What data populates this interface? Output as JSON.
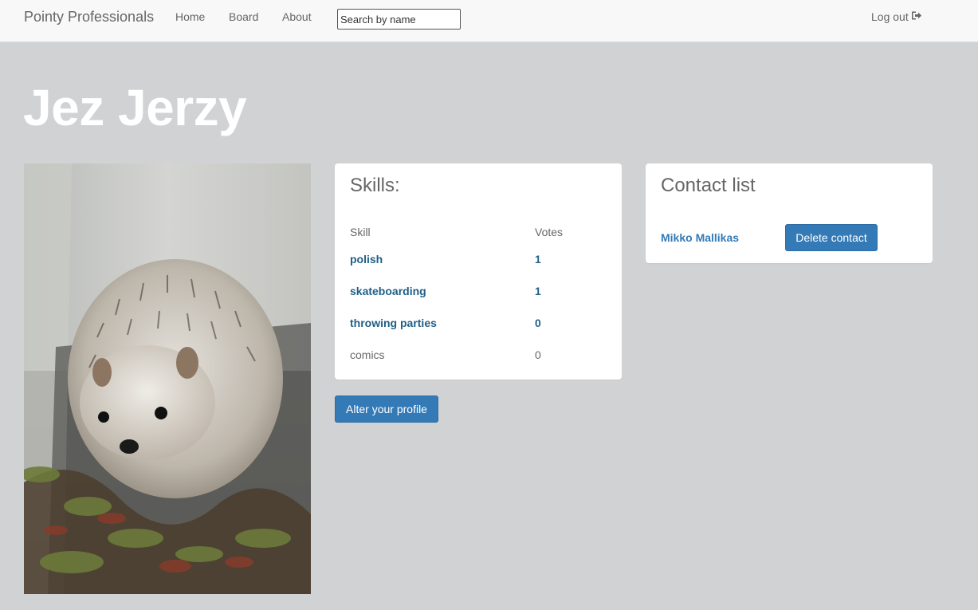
{
  "nav": {
    "brand": "Pointy Professionals",
    "links": [
      "Home",
      "Board",
      "About"
    ],
    "search_placeholder": "Search by name",
    "logout_label": "Log out",
    "logout_icon": "sign-out-icon"
  },
  "profile": {
    "name": "Jez Jerzy",
    "photo_description_icon": "hedgehog-photo"
  },
  "skills": {
    "heading": "Skills:",
    "columns": [
      "Skill",
      "Votes"
    ],
    "rows": [
      {
        "skill": "polish",
        "votes": "1",
        "linked": true
      },
      {
        "skill": "skateboarding",
        "votes": "1",
        "linked": true
      },
      {
        "skill": "throwing parties",
        "votes": "0",
        "linked": true
      },
      {
        "skill": "comics",
        "votes": "0",
        "linked": false
      }
    ],
    "alter_button": "Alter your profile"
  },
  "contacts": {
    "heading": "Contact list",
    "items": [
      {
        "name": "Mikko Mallikas",
        "delete_label": "Delete contact"
      }
    ]
  },
  "colors": {
    "background": "#d1d2d4",
    "primary": "#337ab7",
    "link_dark": "#1f5f86"
  }
}
